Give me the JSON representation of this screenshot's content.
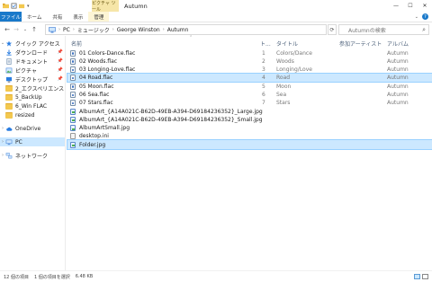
{
  "window": {
    "title": "Autumn",
    "context_tab": "ピクチャ ツール",
    "controls": [
      "—",
      "☐",
      "✕"
    ]
  },
  "ribbon": {
    "tabs": [
      "ファイル",
      "ホーム",
      "共有",
      "表示",
      "管理"
    ]
  },
  "address": {
    "crumbs": [
      "PC",
      "ミュージック",
      "George Winston",
      "Autumn"
    ],
    "search_placeholder": "Autumnの検索"
  },
  "nav": {
    "items": [
      {
        "label": "クイック アクセス",
        "pinned": false
      },
      {
        "label": "ダウンロード",
        "pinned": true
      },
      {
        "label": "ドキュメント",
        "pinned": true
      },
      {
        "label": "ピクチャ",
        "pinned": true
      },
      {
        "label": "デスクトップ",
        "pinned": true
      },
      {
        "label": "2_エクスペリエンス",
        "pinned": false
      },
      {
        "label": "5_BackUp",
        "pinned": false
      },
      {
        "label": "6_Win FLAC",
        "pinned": false
      },
      {
        "label": "resized",
        "pinned": false
      },
      {
        "label": "OneDrive",
        "pinned": false
      },
      {
        "label": "PC",
        "pinned": false
      },
      {
        "label": "ネットワーク",
        "pinned": false
      }
    ]
  },
  "columns": {
    "name": "名前",
    "track": "ト...",
    "title": "タイトル",
    "artist": "参加アーティスト",
    "album": "アルバム"
  },
  "files": [
    {
      "name": "01 Colors-Dance.flac",
      "type": "audio",
      "track": "1",
      "title": "Colors/Dance",
      "album": "Autumn"
    },
    {
      "name": "02 Woods.flac",
      "type": "audio",
      "track": "2",
      "title": "Woods",
      "album": "Autumn"
    },
    {
      "name": "03 Longing-Love.flac",
      "type": "audio",
      "track": "3",
      "title": "Longing/Love",
      "album": "Autumn"
    },
    {
      "name": "04 Road.flac",
      "type": "audio",
      "track": "4",
      "title": "Road",
      "album": "Autumn"
    },
    {
      "name": "05 Moon.flac",
      "type": "audio",
      "track": "5",
      "title": "Moon",
      "album": "Autumn"
    },
    {
      "name": "06 Sea.flac",
      "type": "audio",
      "track": "6",
      "title": "Sea",
      "album": "Autumn"
    },
    {
      "name": "07 Stars.flac",
      "type": "audio",
      "track": "7",
      "title": "Stars",
      "album": "Autumn"
    },
    {
      "name": "AlbumArt_{A14A021C-B62D-49EB-A394-D69184236352}_Large.jpg",
      "type": "img",
      "track": "",
      "title": "",
      "album": ""
    },
    {
      "name": "AlbumArt_{A14A021C-B62D-49EB-A394-D69184236352}_Small.jpg",
      "type": "img",
      "track": "",
      "title": "",
      "album": ""
    },
    {
      "name": "AlbumArtSmall.jpg",
      "type": "img",
      "track": "",
      "title": "",
      "album": ""
    },
    {
      "name": "desktop.ini",
      "type": "ini",
      "track": "",
      "title": "",
      "album": ""
    },
    {
      "name": "Folder.jpg",
      "type": "img",
      "track": "",
      "title": "",
      "album": "",
      "selected": true
    }
  ],
  "status": {
    "count": "12 個の項目",
    "selection": "1 個の項目を選択",
    "size": "6.48 KB"
  }
}
